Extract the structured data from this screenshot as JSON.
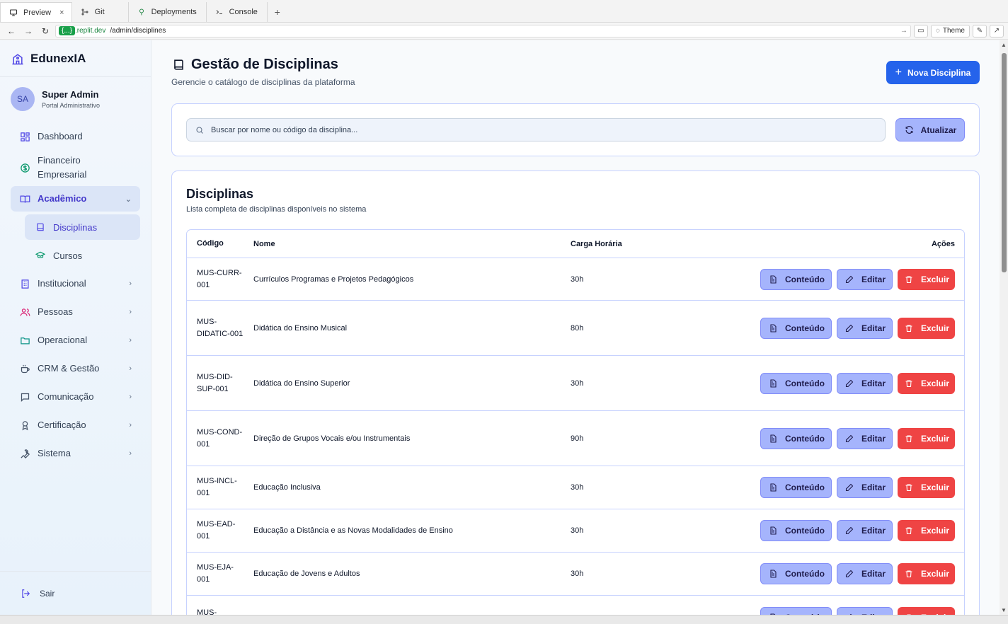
{
  "ide": {
    "tabs": [
      {
        "label": "Preview",
        "icon": "monitor-icon",
        "active": true
      },
      {
        "label": "Git",
        "icon": "git-icon",
        "active": false
      },
      {
        "label": "Deployments",
        "icon": "deploy-icon",
        "active": false
      },
      {
        "label": "Console",
        "icon": "terminal-icon",
        "active": false
      }
    ],
    "close_glyph": "×",
    "plus_glyph": "+",
    "url_host": "{...}",
    "url_host_suffix": ".replit.dev",
    "url_path": "/admin/disciplines",
    "theme_label": "Theme"
  },
  "sidebar": {
    "brand": "EdunexIA",
    "user_initials": "SA",
    "user_name": "Super Admin",
    "user_role": "Portal Administrativo",
    "items": [
      {
        "label": "Dashboard",
        "icon": "dashboard-icon"
      },
      {
        "label": "Financeiro Empresarial",
        "icon": "dollar-icon"
      },
      {
        "label": "Acadêmico",
        "icon": "book-open-icon"
      },
      {
        "label": "Disciplinas",
        "icon": "book-icon"
      },
      {
        "label": "Cursos",
        "icon": "graduation-cap-icon"
      },
      {
        "label": "Institucional",
        "icon": "building-icon"
      },
      {
        "label": "Pessoas",
        "icon": "users-icon"
      },
      {
        "label": "Operacional",
        "icon": "folder-icon"
      },
      {
        "label": "CRM & Gestão",
        "icon": "coffee-icon"
      },
      {
        "label": "Comunicação",
        "icon": "message-icon"
      },
      {
        "label": "Certificação",
        "icon": "award-icon"
      },
      {
        "label": "Sistema",
        "icon": "wrench-icon"
      }
    ],
    "logout": "Sair"
  },
  "page": {
    "title": "Gestão de Disciplinas",
    "subtitle": "Gerencie o catálogo de disciplinas da plataforma",
    "new_button": "Nova Disciplina",
    "search_placeholder": "Buscar por nome ou código da disciplina...",
    "refresh_button": "Atualizar"
  },
  "list": {
    "title": "Disciplinas",
    "subtitle": "Lista completa de disciplinas disponíveis no sistema",
    "columns": [
      "Código",
      "Nome",
      "Carga Horária",
      "Ações"
    ],
    "action_labels": {
      "content": "Conteúdo",
      "edit": "Editar",
      "delete": "Excluir"
    },
    "rows": [
      {
        "code": "MUS-CURR-001",
        "name": "Currículos Programas e Projetos Pedagógicos",
        "hours": "30h"
      },
      {
        "code": "MUS-DIDATIC-001",
        "name": "Didática do Ensino Musical",
        "hours": "80h"
      },
      {
        "code": "MUS-DID-SUP-001",
        "name": "Didática do Ensino Superior",
        "hours": "30h"
      },
      {
        "code": "MUS-COND-001",
        "name": "Direção de Grupos Vocais e/ou Instrumentais",
        "hours": "90h"
      },
      {
        "code": "MUS-INCL-001",
        "name": "Educação Inclusiva",
        "hours": "30h"
      },
      {
        "code": "MUS-EAD-001",
        "name": "Educação a Distância e as Novas Modalidades de Ensino",
        "hours": "30h"
      },
      {
        "code": "MUS-EJA-001",
        "name": "Educação de Jovens e Adultos",
        "hours": "30h"
      },
      {
        "code": "MUS-",
        "name": "",
        "hours": ""
      }
    ]
  }
}
